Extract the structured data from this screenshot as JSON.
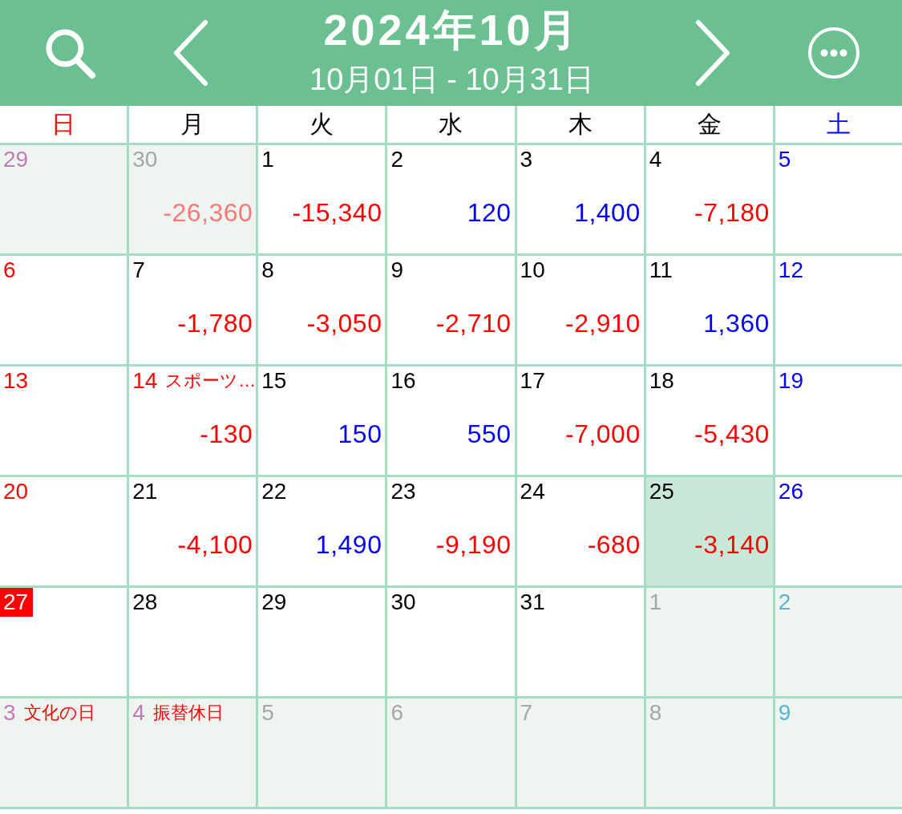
{
  "header": {
    "title": "2024年10月",
    "subtitle": "10月01日 - 10月31日"
  },
  "weekdays": [
    {
      "label": "日",
      "color": "#ff0000"
    },
    {
      "label": "月",
      "color": "#000000"
    },
    {
      "label": "火",
      "color": "#000000"
    },
    {
      "label": "水",
      "color": "#000000"
    },
    {
      "label": "木",
      "color": "#000000"
    },
    {
      "label": "金",
      "color": "#000000"
    },
    {
      "label": "土",
      "color": "#0000ff"
    }
  ],
  "weeks": [
    {
      "days": [
        {
          "date": {
            "text": "29",
            "color": "#c47ab8"
          },
          "in_month": false,
          "selected": false,
          "today": false
        },
        {
          "date": {
            "text": "30",
            "color": "#a6a6a6"
          },
          "in_month": false,
          "selected": false,
          "today": false,
          "amount": {
            "text": "-26,360",
            "color": "#ff7878"
          }
        },
        {
          "date": {
            "text": "1",
            "color": "#000000"
          },
          "in_month": true,
          "selected": false,
          "today": false,
          "amount": {
            "text": "-15,340",
            "color": "#ff0000"
          }
        },
        {
          "date": {
            "text": "2",
            "color": "#000000"
          },
          "in_month": true,
          "selected": false,
          "today": false,
          "amount": {
            "text": "120",
            "color": "#0000ff"
          }
        },
        {
          "date": {
            "text": "3",
            "color": "#000000"
          },
          "in_month": true,
          "selected": false,
          "today": false,
          "amount": {
            "text": "1,400",
            "color": "#0000ff"
          }
        },
        {
          "date": {
            "text": "4",
            "color": "#000000"
          },
          "in_month": true,
          "selected": false,
          "today": false,
          "amount": {
            "text": "-7,180",
            "color": "#ff0000"
          }
        },
        {
          "date": {
            "text": "5",
            "color": "#0000ff"
          },
          "in_month": true,
          "selected": false,
          "today": false
        }
      ]
    },
    {
      "days": [
        {
          "date": {
            "text": "6",
            "color": "#ff0000"
          },
          "in_month": true,
          "selected": false,
          "today": false
        },
        {
          "date": {
            "text": "7",
            "color": "#000000"
          },
          "in_month": true,
          "selected": false,
          "today": false,
          "amount": {
            "text": "-1,780",
            "color": "#ff0000"
          }
        },
        {
          "date": {
            "text": "8",
            "color": "#000000"
          },
          "in_month": true,
          "selected": false,
          "today": false,
          "amount": {
            "text": "-3,050",
            "color": "#ff0000"
          }
        },
        {
          "date": {
            "text": "9",
            "color": "#000000"
          },
          "in_month": true,
          "selected": false,
          "today": false,
          "amount": {
            "text": "-2,710",
            "color": "#ff0000"
          }
        },
        {
          "date": {
            "text": "10",
            "color": "#000000"
          },
          "in_month": true,
          "selected": false,
          "today": false,
          "amount": {
            "text": "-2,910",
            "color": "#ff0000"
          }
        },
        {
          "date": {
            "text": "11",
            "color": "#000000"
          },
          "in_month": true,
          "selected": false,
          "today": false,
          "amount": {
            "text": "1,360",
            "color": "#0000ff"
          }
        },
        {
          "date": {
            "text": "12",
            "color": "#0000ff"
          },
          "in_month": true,
          "selected": false,
          "today": false
        }
      ]
    },
    {
      "days": [
        {
          "date": {
            "text": "13",
            "color": "#ff0000"
          },
          "in_month": true,
          "selected": false,
          "today": false
        },
        {
          "date": {
            "text": "14",
            "color": "#ff0000"
          },
          "in_month": true,
          "selected": false,
          "today": false,
          "holiday": {
            "text": "スポーツ…",
            "color": "#ff0000"
          },
          "amount": {
            "text": "-130",
            "color": "#ff0000"
          }
        },
        {
          "date": {
            "text": "15",
            "color": "#000000"
          },
          "in_month": true,
          "selected": false,
          "today": false,
          "amount": {
            "text": "150",
            "color": "#0000ff"
          }
        },
        {
          "date": {
            "text": "16",
            "color": "#000000"
          },
          "in_month": true,
          "selected": false,
          "today": false,
          "amount": {
            "text": "550",
            "color": "#0000ff"
          }
        },
        {
          "date": {
            "text": "17",
            "color": "#000000"
          },
          "in_month": true,
          "selected": false,
          "today": false,
          "amount": {
            "text": "-7,000",
            "color": "#ff0000"
          }
        },
        {
          "date": {
            "text": "18",
            "color": "#000000"
          },
          "in_month": true,
          "selected": false,
          "today": false,
          "amount": {
            "text": "-5,430",
            "color": "#ff0000"
          }
        },
        {
          "date": {
            "text": "19",
            "color": "#0000ff"
          },
          "in_month": true,
          "selected": false,
          "today": false
        }
      ]
    },
    {
      "days": [
        {
          "date": {
            "text": "20",
            "color": "#ff0000"
          },
          "in_month": true,
          "selected": false,
          "today": false
        },
        {
          "date": {
            "text": "21",
            "color": "#000000"
          },
          "in_month": true,
          "selected": false,
          "today": false,
          "amount": {
            "text": "-4,100",
            "color": "#ff0000"
          }
        },
        {
          "date": {
            "text": "22",
            "color": "#000000"
          },
          "in_month": true,
          "selected": false,
          "today": false,
          "amount": {
            "text": "1,490",
            "color": "#0000ff"
          }
        },
        {
          "date": {
            "text": "23",
            "color": "#000000"
          },
          "in_month": true,
          "selected": false,
          "today": false,
          "amount": {
            "text": "-9,190",
            "color": "#ff0000"
          }
        },
        {
          "date": {
            "text": "24",
            "color": "#000000"
          },
          "in_month": true,
          "selected": false,
          "today": false,
          "amount": {
            "text": "-680",
            "color": "#ff0000"
          }
        },
        {
          "date": {
            "text": "25",
            "color": "#000000"
          },
          "in_month": true,
          "selected": true,
          "today": false,
          "amount": {
            "text": "-3,140",
            "color": "#ff0000"
          }
        },
        {
          "date": {
            "text": "26",
            "color": "#0000ff"
          },
          "in_month": true,
          "selected": false,
          "today": false
        }
      ]
    },
    {
      "days": [
        {
          "date": {
            "text": "27"
          },
          "in_month": true,
          "selected": false,
          "today": true
        },
        {
          "date": {
            "text": "28",
            "color": "#000000"
          },
          "in_month": true,
          "selected": false,
          "today": false
        },
        {
          "date": {
            "text": "29",
            "color": "#000000"
          },
          "in_month": true,
          "selected": false,
          "today": false
        },
        {
          "date": {
            "text": "30",
            "color": "#000000"
          },
          "in_month": true,
          "selected": false,
          "today": false
        },
        {
          "date": {
            "text": "31",
            "color": "#000000"
          },
          "in_month": true,
          "selected": false,
          "today": false
        },
        {
          "date": {
            "text": "1",
            "color": "#a6a6a6"
          },
          "in_month": false,
          "selected": false,
          "today": false
        },
        {
          "date": {
            "text": "2",
            "color": "#52b5d6"
          },
          "in_month": false,
          "selected": false,
          "today": false
        }
      ]
    },
    {
      "days": [
        {
          "date": {
            "text": "3",
            "color": "#c47ab8"
          },
          "in_month": false,
          "selected": false,
          "today": false,
          "holiday": {
            "text": "文化の日",
            "color": "#ff0000"
          }
        },
        {
          "date": {
            "text": "4",
            "color": "#c47ab8"
          },
          "in_month": false,
          "selected": false,
          "today": false,
          "holiday": {
            "text": "振替休日",
            "color": "#ff0000"
          }
        },
        {
          "date": {
            "text": "5",
            "color": "#a6a6a6"
          },
          "in_month": false,
          "selected": false,
          "today": false
        },
        {
          "date": {
            "text": "6",
            "color": "#a6a6a6"
          },
          "in_month": false,
          "selected": false,
          "today": false
        },
        {
          "date": {
            "text": "7",
            "color": "#a6a6a6"
          },
          "in_month": false,
          "selected": false,
          "today": false
        },
        {
          "date": {
            "text": "8",
            "color": "#a6a6a6"
          },
          "in_month": false,
          "selected": false,
          "today": false
        },
        {
          "date": {
            "text": "9",
            "color": "#52b5d6"
          },
          "in_month": false,
          "selected": false,
          "today": false
        }
      ]
    }
  ]
}
